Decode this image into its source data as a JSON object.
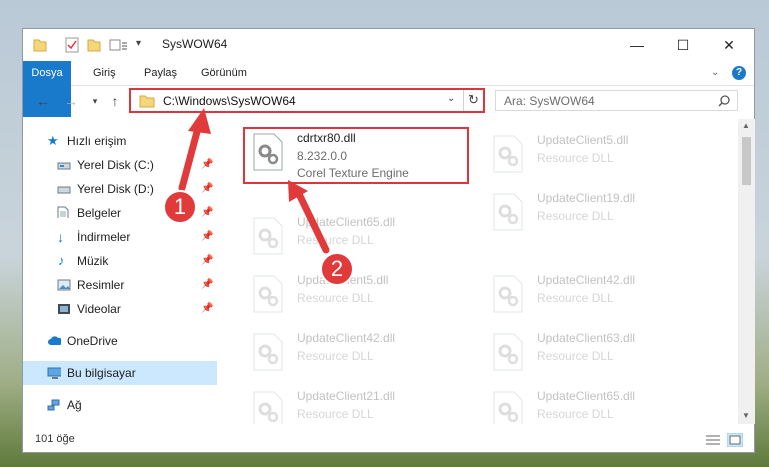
{
  "window": {
    "title": "SysWOW64",
    "controls": {
      "minimize": "—",
      "maximize": "☐",
      "close": "✕"
    }
  },
  "ribbon": {
    "tabs": [
      "Dosya",
      "Giriş",
      "Paylaş",
      "Görünüm"
    ],
    "help": "?"
  },
  "address": {
    "path": "C:\\Windows\\SysWOW64",
    "search_placeholder": "Ara: SysWOW64"
  },
  "sidebar": {
    "items": [
      {
        "label": "Hızlı erişim",
        "icon": "star-icon"
      },
      {
        "label": "Yerel Disk (C:)",
        "icon": "drive-icon"
      },
      {
        "label": "Yerel Disk (D:)",
        "icon": "drive-icon"
      },
      {
        "label": "Belgeler",
        "icon": "documents-icon"
      },
      {
        "label": "İndirmeler",
        "icon": "download-icon"
      },
      {
        "label": "Müzik",
        "icon": "music-icon"
      },
      {
        "label": "Resimler",
        "icon": "pictures-icon"
      },
      {
        "label": "Videolar",
        "icon": "videos-icon"
      },
      {
        "label": "OneDrive",
        "icon": "cloud-icon"
      },
      {
        "label": "Bu bilgisayar",
        "icon": "computer-icon"
      },
      {
        "label": "Ağ",
        "icon": "network-icon"
      }
    ]
  },
  "files": {
    "col1": [
      {
        "name": "cdrtxr80.dll",
        "version": "8.232.0.0",
        "desc": "Corel Texture Engine"
      },
      {
        "name": "UpdateClient65.dll",
        "desc": "Resource DLL"
      },
      {
        "name": "UpdateClient5.dll",
        "desc": "Resource DLL"
      },
      {
        "name": "UpdateClient42.dll",
        "desc": "Resource DLL"
      },
      {
        "name": "UpdateClient21.dll",
        "desc": "Resource DLL"
      }
    ],
    "col2": [
      {
        "name": "UpdateClient5.dll",
        "desc": "Resource DLL"
      },
      {
        "name": "UpdateClient19.dll",
        "desc": "Resource DLL"
      },
      {
        "name": "UpdateClient42.dll",
        "desc": "Resource DLL"
      },
      {
        "name": "UpdateClient63.dll",
        "desc": "Resource DLL"
      },
      {
        "name": "UpdateClient65.dll",
        "desc": "Resource DLL"
      }
    ]
  },
  "status": {
    "count": "101 öğe"
  },
  "annotations": {
    "badge1": "1",
    "badge2": "2"
  },
  "colors": {
    "accent": "#1979ca",
    "highlight": "#d9363e",
    "selection": "#cce8ff"
  }
}
